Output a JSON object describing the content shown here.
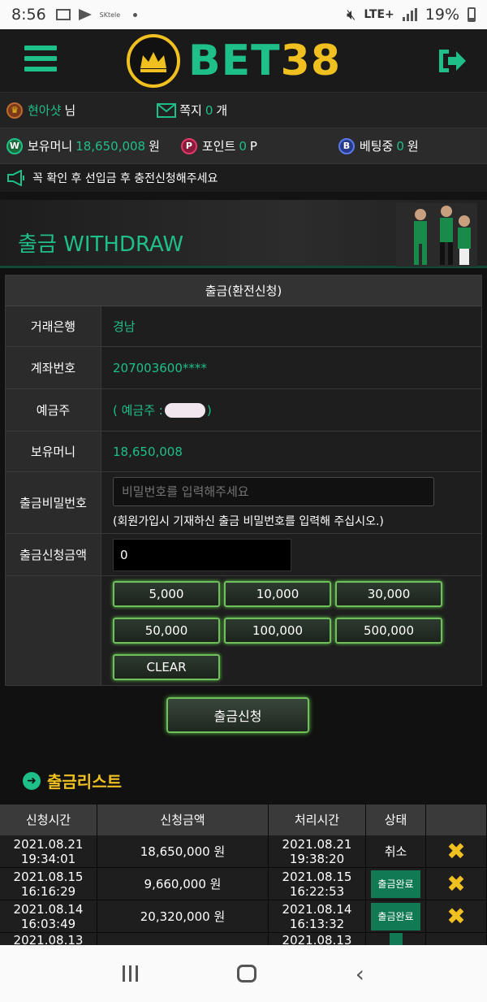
{
  "status_bar": {
    "time": "8:56",
    "carrier_tag": "SKtele",
    "network": "LTE+",
    "battery": "19%"
  },
  "header": {
    "logo_bet": "BET",
    "logo_num": "38"
  },
  "user": {
    "name": "현아샷",
    "name_suffix": "님",
    "message_label": "쪽지",
    "message_count": "0",
    "message_unit": "개",
    "money_label": "보유머니",
    "money_value": "18,650,008",
    "money_unit": "원",
    "point_label": "포인트",
    "point_value": "0",
    "point_unit": "P",
    "betting_label": "베팅중",
    "betting_value": "0",
    "betting_unit": "원"
  },
  "notice": "꼭 확인 후 선입금 후 충전신청해주세요",
  "banner": {
    "title_kr": "출금",
    "title_en": "WITHDRAW"
  },
  "form": {
    "header": "출금(환전신청)",
    "bank_label": "거래은행",
    "bank_value": "경남",
    "account_label": "계좌번호",
    "account_value": "207003600****",
    "holder_label": "예금주",
    "holder_prefix": "( 예금주 :",
    "holder_suffix": ")",
    "balance_label": "보유머니",
    "balance_value": "18,650,008",
    "password_label": "출금비밀번호",
    "password_placeholder": "비밀번호를 입력해주세요",
    "password_note": "(회원가입시 기재하신 출금 비밀번호를 입력해 주십시오.)",
    "amount_label": "출금신청금액",
    "amount_value": "0",
    "amount_buttons": [
      "5,000",
      "10,000",
      "30,000",
      "50,000",
      "100,000",
      "500,000"
    ],
    "clear_label": "CLEAR"
  },
  "submit_label": "출금신청",
  "list": {
    "title": "출금리스트",
    "headers": [
      "신청시간",
      "신청금액",
      "처리시간",
      "상태",
      ""
    ],
    "rows": [
      {
        "req_date": "2021.08.21",
        "req_time": "19:34:01",
        "amount": "18,650,000 원",
        "done_date": "2021.08.21",
        "done_time": "19:38:20",
        "status": "취소"
      },
      {
        "req_date": "2021.08.15",
        "req_time": "16:16:29",
        "amount": "9,660,000 원",
        "done_date": "2021.08.15",
        "done_time": "16:22:53",
        "status": "출금완료"
      },
      {
        "req_date": "2021.08.14",
        "req_time": "16:03:49",
        "amount": "20,320,000 원",
        "done_date": "2021.08.14",
        "done_time": "16:13:32",
        "status": "출금완료"
      },
      {
        "req_date": "2021.08.13",
        "req_time": "",
        "amount": "",
        "done_date": "2021.08.13",
        "done_time": "",
        "status": ""
      }
    ]
  }
}
